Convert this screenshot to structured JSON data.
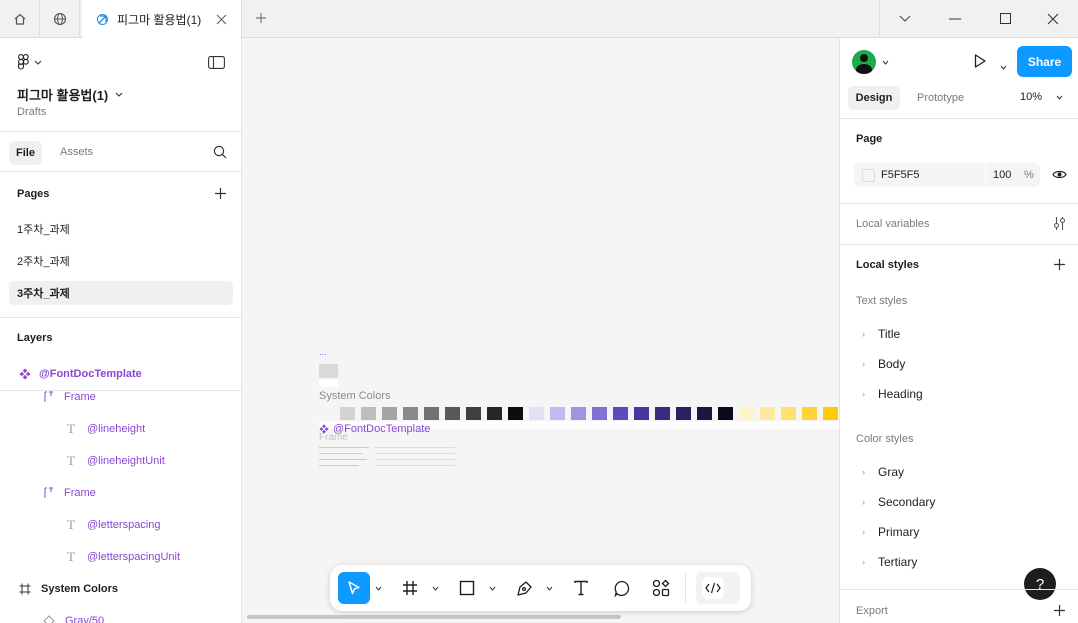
{
  "titlebar": {
    "tab_title": "피그마 활용법(1)",
    "icons": [
      "home-icon",
      "globe-icon",
      "figma-file-icon",
      "close-icon",
      "plus-icon",
      "chevron-down-icon",
      "minimize-icon",
      "maximize-icon",
      "close-window-icon"
    ]
  },
  "left": {
    "file_name": "피그마 활용법(1)",
    "location": "Drafts",
    "tabs": {
      "file": "File",
      "assets": "Assets"
    },
    "pages_label": "Pages",
    "pages": [
      {
        "label": "1주차_과제"
      },
      {
        "label": "2주차_과제"
      },
      {
        "label": "3주차_과제"
      }
    ],
    "layers_label": "Layers",
    "layers": [
      {
        "label": "@FontDocTemplate"
      },
      {
        "label": "Frame"
      },
      {
        "label": "@lineheight"
      },
      {
        "label": "@lineheightUnit"
      },
      {
        "label": "Frame"
      },
      {
        "label": "@letterspacing"
      },
      {
        "label": "@letterspacingUnit"
      },
      {
        "label": "System Colors"
      },
      {
        "label": "Gray/50"
      }
    ]
  },
  "canvas": {
    "ellipsis": "...",
    "system_colors_label": "System Colors",
    "component_label": "@FontDocTemplate",
    "frame_label": "Frame",
    "swatch_colors": [
      "#d3d3d3",
      "#bdbdbd",
      "#a4a4a4",
      "#8a8a8a",
      "#717171",
      "#585858",
      "#3f3f3f",
      "#262626",
      "#0d0d0d",
      "#e4e0f4",
      "#c4b9ee",
      "#a292e0",
      "#8270d4",
      "#5f48c0",
      "#4a36a0",
      "#3a2b80",
      "#2b2160",
      "#1c1740",
      "#0b0a1c",
      "#fff4c8",
      "#ffe9a0",
      "#ffe070",
      "#ffd43a",
      "#ffcb05"
    ]
  },
  "right": {
    "share_label": "Share",
    "tabs": {
      "design": "Design",
      "prototype": "Prototype"
    },
    "zoom": "10%",
    "page_label": "Page",
    "page_color": "F5F5F5",
    "page_opacity": "100",
    "percent": "%",
    "local_variables": "Local variables",
    "local_styles": "Local styles",
    "text_styles_label": "Text styles",
    "text_styles": [
      "Title",
      "Body",
      "Heading"
    ],
    "color_styles_label": "Color styles",
    "color_styles": [
      "Gray",
      "Secondary",
      "Primary",
      "Tertiary"
    ],
    "export_label": "Export",
    "help": "?"
  }
}
